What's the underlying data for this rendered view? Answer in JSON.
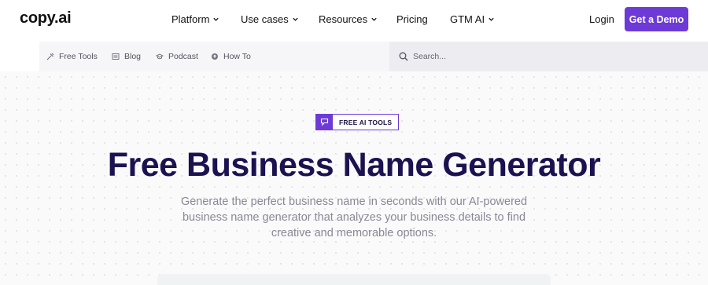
{
  "brand": {
    "logo": "copy.ai",
    "accent": "#6d3ad8",
    "title_color": "#1c1250"
  },
  "nav": {
    "items": [
      {
        "label": "Platform",
        "dropdown": true
      },
      {
        "label": "Use cases",
        "dropdown": true
      },
      {
        "label": "Resources",
        "dropdown": true
      },
      {
        "label": "Pricing",
        "dropdown": false
      },
      {
        "label": "GTM AI",
        "dropdown": true
      }
    ],
    "login": "Login",
    "cta": "Get a Demo"
  },
  "subnav": {
    "items": [
      {
        "label": "Free Tools",
        "icon": "tools-icon"
      },
      {
        "label": "Blog",
        "icon": "blog-icon"
      },
      {
        "label": "Podcast",
        "icon": "podcast-icon"
      },
      {
        "label": "How To",
        "icon": "howto-icon"
      }
    ]
  },
  "search": {
    "placeholder": "Search..."
  },
  "hero": {
    "badge": "FREE AI TOOLS",
    "title": "Free Business Name Generator",
    "subtitle": "Generate the perfect business name in seconds with our AI-powered business name generator that analyzes your business details to find creative and memorable options."
  }
}
